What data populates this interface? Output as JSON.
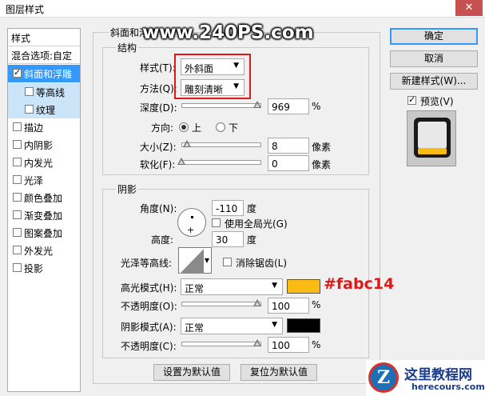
{
  "window": {
    "title": "图层样式",
    "close_glyph": "✕"
  },
  "watermark": "www.240PS.com",
  "styles_list": {
    "header": "样式",
    "blend": "混合选项:自定",
    "items": [
      {
        "label": "斜面和浮雕",
        "checked": true
      },
      {
        "label": "等高线",
        "checked": false
      },
      {
        "label": "纹理",
        "checked": false
      },
      {
        "label": "描边",
        "checked": false
      },
      {
        "label": "内阴影",
        "checked": false
      },
      {
        "label": "内发光",
        "checked": false
      },
      {
        "label": "光泽",
        "checked": false
      },
      {
        "label": "颜色叠加",
        "checked": false
      },
      {
        "label": "渐变叠加",
        "checked": false
      },
      {
        "label": "图案叠加",
        "checked": false
      },
      {
        "label": "外发光",
        "checked": false
      },
      {
        "label": "投影",
        "checked": false
      }
    ]
  },
  "bevel": {
    "group_title": "斜面和浮雕",
    "structure_title": "结构",
    "style_label": "样式(T):",
    "style_value": "外斜面",
    "technique_label": "方法(Q):",
    "technique_value": "雕刻清晰",
    "depth_label": "深度(D):",
    "depth_value": "969",
    "depth_unit": "%",
    "depth_level": 1.0,
    "direction_label": "方向:",
    "direction_up": "上",
    "direction_down": "下",
    "size_label": "大小(Z):",
    "size_value": "8",
    "size_unit": "像素",
    "soften_label": "软化(F):",
    "soften_value": "0",
    "soften_unit": "像素"
  },
  "shading": {
    "title": "阴影",
    "angle_label": "角度(N):",
    "angle_value": "-110",
    "angle_unit": "度",
    "global_light_label": "使用全局光(G)",
    "altitude_label": "高度:",
    "altitude_value": "30",
    "altitude_unit": "度",
    "gloss_label": "光泽等高线:",
    "antialias_label": "消除锯齿(L)",
    "highlight_mode_label": "高光模式(H):",
    "highlight_mode_value": "正常",
    "highlight_color": "#fabc14",
    "highlight_color_label": "#fabc14",
    "highlight_opacity_label": "不透明度(O):",
    "highlight_opacity_value": "100",
    "highlight_opacity_unit": "%",
    "shadow_mode_label": "阴影模式(A):",
    "shadow_mode_value": "正常",
    "shadow_color": "#000000",
    "shadow_opacity_label": "不透明度(C):",
    "shadow_opacity_value": "100",
    "shadow_opacity_unit": "%"
  },
  "bottom_buttons": {
    "set_default": "设置为默认值",
    "reset_default": "复位为默认值"
  },
  "right_buttons": {
    "ok": "确定",
    "cancel": "取消",
    "new_style": "新建样式(W)...",
    "preview": "预览(V)"
  },
  "logo": {
    "mark": "Z",
    "cn": "这里教程网",
    "en": "herecours.com"
  }
}
